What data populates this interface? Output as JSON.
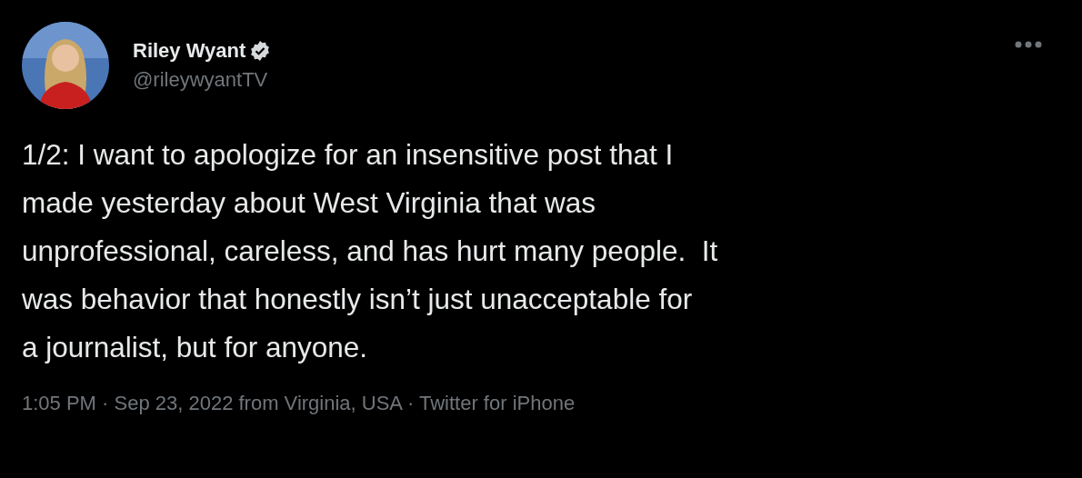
{
  "author": {
    "name": "Riley Wyant",
    "verified": true,
    "handle": "@rileywyantTV"
  },
  "tweet": {
    "lines": [
      "1/2: I want to apologize for an insensitive post that I",
      "made yesterday about West Virginia that was",
      "unprofessional, careless, and has hurt many people.  It",
      "was behavior that honestly isn’t just unacceptable for",
      "a journalist, but for anyone."
    ]
  },
  "footer": "1:05 PM · Sep 23, 2022 from Virginia, USA · Twitter for iPhone"
}
